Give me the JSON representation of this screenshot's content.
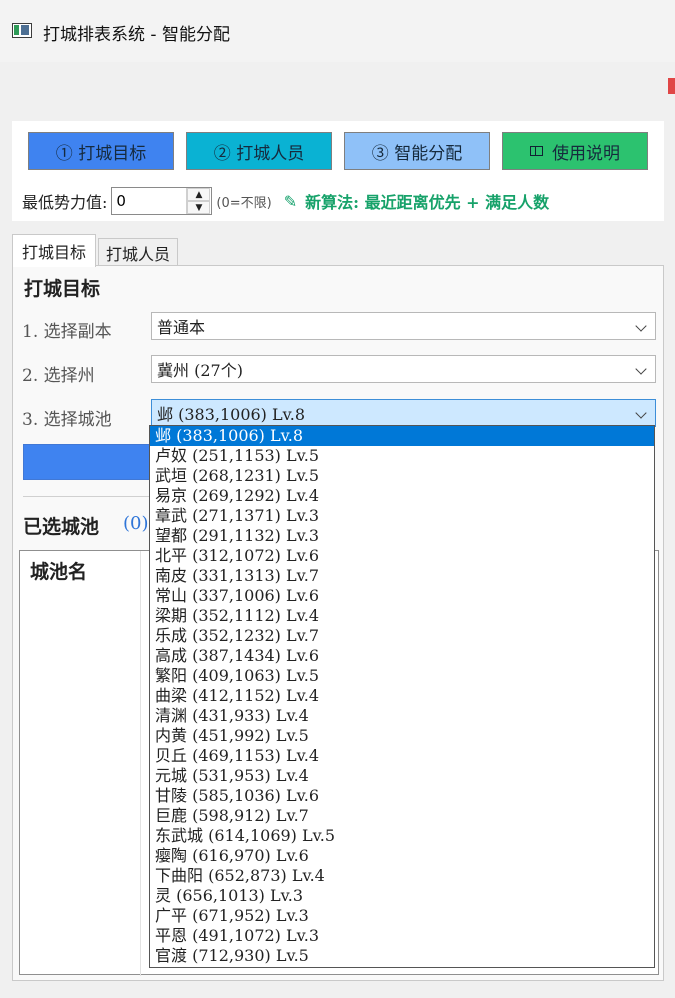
{
  "window": {
    "title": "打城排表系统 - 智能分配"
  },
  "toolbar": {
    "buttons": [
      {
        "label": "① 打城目标",
        "color": "#3f83f0"
      },
      {
        "label": "② 打城人员",
        "color": "#0ab2d3"
      },
      {
        "label": "③ 智能分配",
        "color": "#8fc1f8"
      },
      {
        "label": "使用说明",
        "color": "#2cc26f"
      }
    ],
    "min_power_label": "最低势力值:",
    "min_power_value": "0",
    "min_power_hint": "(0=不限)",
    "algo_text": "新算法: 最近距离优先 + 满足人数"
  },
  "tabs": [
    {
      "label": "打城目标",
      "active": true
    },
    {
      "label": "打城人员",
      "active": false
    }
  ],
  "panel": {
    "title": "打城目标",
    "steps": [
      {
        "label": "1. 选择副本",
        "value": "普通本"
      },
      {
        "label": "2. 选择州",
        "value": "冀州 (27个)"
      },
      {
        "label": "3. 选择城池",
        "value": "邺 (383,1006) Lv.8"
      }
    ],
    "selected": {
      "title": "已选城池",
      "count": "(0)"
    },
    "table": {
      "column_name": "城池名"
    }
  },
  "city_dropdown": {
    "selected_index": 0,
    "options": [
      "邺 (383,1006) Lv.8",
      "卢奴 (251,1153) Lv.5",
      "武垣 (268,1231) Lv.5",
      "易京 (269,1292) Lv.4",
      "章武 (271,1371) Lv.3",
      "望都 (291,1132) Lv.3",
      "北平 (312,1072) Lv.6",
      "南皮 (331,1313) Lv.7",
      "常山 (337,1006) Lv.6",
      "梁期 (352,1112) Lv.4",
      "乐成 (352,1232) Lv.7",
      "高成 (387,1434) Lv.6",
      "繁阳 (409,1063) Lv.5",
      "曲梁 (412,1152) Lv.4",
      "清渊 (431,933) Lv.4",
      "内黄 (451,992) Lv.5",
      "贝丘 (469,1153) Lv.4",
      "元城 (531,953) Lv.4",
      "甘陵 (585,1036) Lv.6",
      "巨鹿 (598,912) Lv.7",
      "东武城 (614,1069) Lv.5",
      "瘿陶 (616,970) Lv.6",
      "下曲阳 (652,873) Lv.4",
      "灵 (656,1013) Lv.3",
      "广平 (671,952) Lv.3",
      "平恩 (491,1072) Lv.3",
      "官渡 (712,930) Lv.5"
    ]
  }
}
